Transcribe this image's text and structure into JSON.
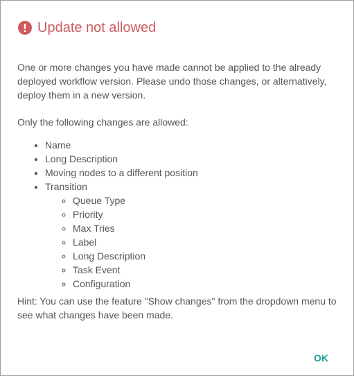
{
  "dialog": {
    "title": "Update not allowed",
    "icon": "error-icon",
    "accent_color": "#cd5b5b",
    "button_color": "#1a9a9a",
    "intro": "One or more changes you have made cannot be applied to the already deployed workflow version. Please undo those changes, or alternatively, deploy them in a new version.",
    "allowed_heading": "Only the following changes are allowed:",
    "allowed_items": [
      {
        "label": "Name"
      },
      {
        "label": "Long Description"
      },
      {
        "label": "Moving nodes to a different position"
      },
      {
        "label": "Transition"
      }
    ],
    "transition_subitems": [
      "Queue Type",
      "Priority",
      "Max Tries",
      "Label",
      "Long Description",
      "Task Event",
      "Configuration"
    ],
    "hint": "Hint: You can use the feature \"Show changes\" from the dropdown menu to see what changes have been made.",
    "ok_label": "OK"
  }
}
